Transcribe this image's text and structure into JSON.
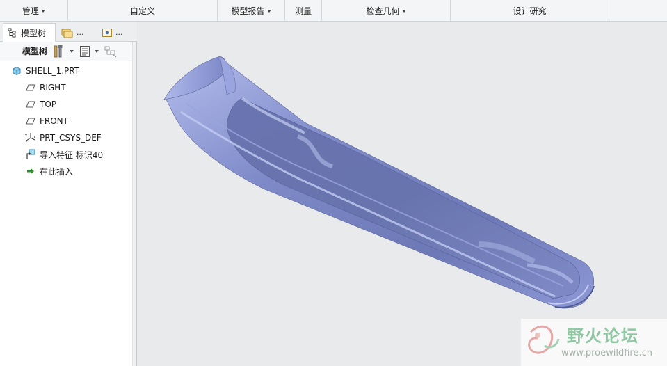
{
  "ribbon": {
    "groups": [
      {
        "label": "管理",
        "dropdown": true
      },
      {
        "label": "自定义",
        "dropdown": false
      },
      {
        "label": "模型报告",
        "dropdown": true
      },
      {
        "label": "测量",
        "dropdown": false
      },
      {
        "label": "检查几何",
        "dropdown": true
      },
      {
        "label": "设计研究",
        "dropdown": false
      }
    ]
  },
  "navigator": {
    "tabs": [
      {
        "label": "模型树",
        "icon": "model-tree-icon",
        "active": true
      },
      {
        "label": "...",
        "icon": "folder-browser-icon",
        "active": false
      },
      {
        "label": "...",
        "icon": "favorites-icon",
        "active": false
      }
    ],
    "toolbar": {
      "label": "模型树",
      "buttons": [
        "settings-tools-icon",
        "show-list-icon",
        "filter-icon"
      ]
    },
    "tree": [
      {
        "label": "SHELL_1.PRT",
        "icon": "part-icon",
        "indent": 0
      },
      {
        "label": "RIGHT",
        "icon": "datum-plane-icon",
        "indent": 1
      },
      {
        "label": "TOP",
        "icon": "datum-plane-icon",
        "indent": 1
      },
      {
        "label": "FRONT",
        "icon": "datum-plane-icon",
        "indent": 1
      },
      {
        "label": "PRT_CSYS_DEF",
        "icon": "coordinate-system-icon",
        "indent": 1
      },
      {
        "label": "导入特征 标识40",
        "icon": "import-feature-icon",
        "indent": 1
      },
      {
        "label": "在此插入",
        "icon": "insert-here-arrow-icon",
        "indent": 1
      }
    ]
  },
  "watermark": {
    "title": "野火论坛",
    "url": "www.proewildfire.cn"
  },
  "colors": {
    "model_base": "#7a86c4",
    "model_highlight": "#b9c2ee",
    "model_shadow": "#5a649e",
    "insert_arrow": "#2e8b2e",
    "watermark_green": "#8ec7a2"
  }
}
